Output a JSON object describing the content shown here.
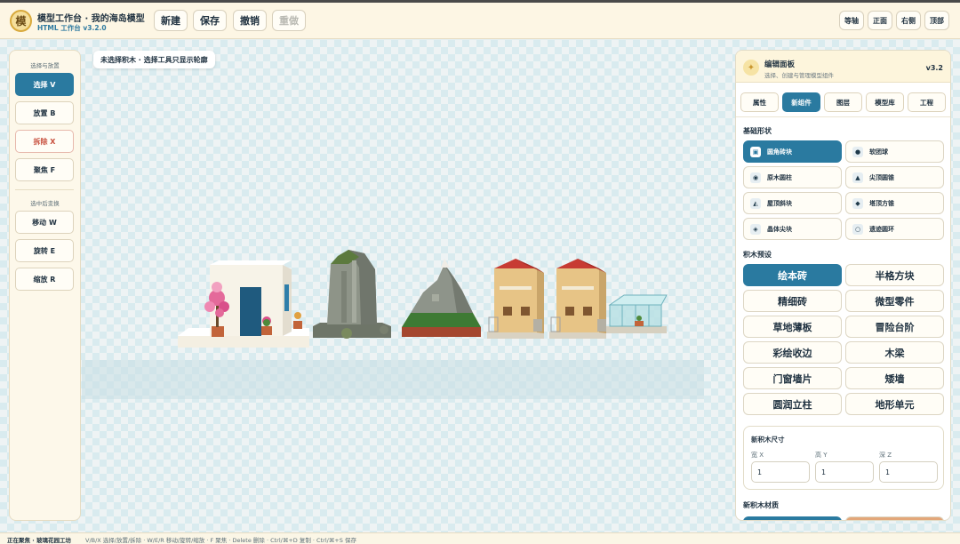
{
  "app": {
    "logo_char": "模",
    "title": "模型工作台 · 我的海岛模型",
    "version": "HTML 工作台 v3.2.0"
  },
  "toolbar": {
    "new_label": "新建",
    "save_label": "保存",
    "undo_label": "撤销",
    "redo_label": "重做"
  },
  "views": {
    "iso": "等轴",
    "front": "正面",
    "side": "右侧",
    "top": "顶部"
  },
  "hint": "未选择积木 · 选择工具只显示轮廓",
  "left_panel": {
    "group1_title": "选择与放置",
    "select": "选择 V",
    "place": "放置 B",
    "remove": "拆除 X",
    "focus": "聚焦 F",
    "group2_title": "选中后变换",
    "move": "移动 W",
    "rotate": "旋转 E",
    "scale": "缩放 R"
  },
  "right_panel": {
    "title": "编辑面板",
    "subtitle": "选择、创建与管理模型组件",
    "version": "v3.2",
    "tabs": [
      "属性",
      "新组件",
      "图层",
      "模型库",
      "工程"
    ],
    "active_tab": 1,
    "basic_shapes_title": "基础形状",
    "shapes": [
      {
        "label": "圆角砖块",
        "icon": "rounded-cube-icon",
        "glyph": "▣"
      },
      {
        "label": "软团球",
        "icon": "sphere-icon",
        "glyph": "●"
      },
      {
        "label": "原木圆柱",
        "icon": "cylinder-icon",
        "glyph": "◉"
      },
      {
        "label": "尖顶圆锥",
        "icon": "cone-icon",
        "glyph": "▲"
      },
      {
        "label": "屋顶斜块",
        "icon": "wedge-icon",
        "glyph": "◭"
      },
      {
        "label": "塔顶方锥",
        "icon": "pyramid-icon",
        "glyph": "◆"
      },
      {
        "label": "晶体尖块",
        "icon": "crystal-icon",
        "glyph": "◈"
      },
      {
        "label": "遗迹圆环",
        "icon": "torus-icon",
        "glyph": "○"
      }
    ],
    "presets_title": "积木预设",
    "presets": [
      "绘本砖",
      "半格方块",
      "精细砖",
      "微型零件",
      "草地薄板",
      "冒险台阶",
      "彩绘收边",
      "木梁",
      "门窗墙片",
      "矮墙",
      "圆润立柱",
      "地形单元"
    ],
    "size_title": "新积木尺寸",
    "size": [
      {
        "label": "宽 X",
        "value": "1"
      },
      {
        "label": "高 Y",
        "value": "1"
      },
      {
        "label": "深 Z",
        "value": "1"
      }
    ],
    "material_title": "新积木材质",
    "material_colors": [
      "#2a7aa0",
      "#e3a77a"
    ]
  },
  "status": {
    "focus": "正在聚焦 · 玻璃花园工坊",
    "shortcuts": "V/B/X 选择/放置/拆除 · W/E/R 移动/旋转/缩放 · F 聚焦 · Delete 删除 · Ctrl/⌘+D 复制 · Ctrl/⌘+S 保存"
  },
  "accent_color": "#2a7aa0"
}
